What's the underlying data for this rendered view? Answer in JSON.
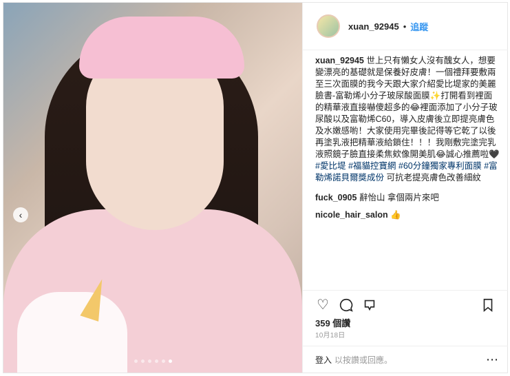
{
  "header": {
    "username": "xuan_92945",
    "separator": "•",
    "follow_label": "追蹤"
  },
  "caption": {
    "username": "xuan_92945",
    "text": "世上只有懶女人沒有醜女人，想要變漂亮的基礎就是保養好皮膚！一個禮拜要敷兩至三次面膜的我今天跟大家介紹愛比堤家的美麗臉書-富勒烯小分子玻尿酸面膜✨打開看到裡面的精華液直接嚇傻超多的😂裡面添加了小分子玻尿酸以及富勒烯C60，導入皮膚後立即提亮膚色及水嫩感喲！大家使用完畢後記得等它乾了以後再塗乳液把精華液給鎖住！！！我剛敷完塗完乳液照鏡子臉直接柔焦欸像開美肌😂誠心推薦啦🖤",
    "tags": [
      "#愛比堤",
      "#福貓控寶網",
      "#60分鐘獨家專利面膜",
      "#富勒烯諾貝爾獎成份"
    ],
    "tail": "可抗老提亮膚色改善細紋"
  },
  "comments": [
    {
      "username": "fuck_0905",
      "text": "辭怡山 拿個兩片來吧"
    },
    {
      "username": "nicole_hair_salon",
      "text": "👍"
    }
  ],
  "actions": {
    "like_icon": "heart-icon",
    "comment_icon": "comment-icon",
    "share_icon": "share-icon",
    "save_icon": "bookmark-icon"
  },
  "likes_text": "359 個讚",
  "date_text": "10月18日",
  "footer": {
    "login_label": "登入",
    "prompt_text": "以按讚或回應。",
    "more_icon": "more-options-icon"
  },
  "carousel": {
    "count": 6,
    "active_index": 5
  },
  "colors": {
    "link": "#3897f0",
    "tag": "#003569",
    "muted": "#999999"
  }
}
